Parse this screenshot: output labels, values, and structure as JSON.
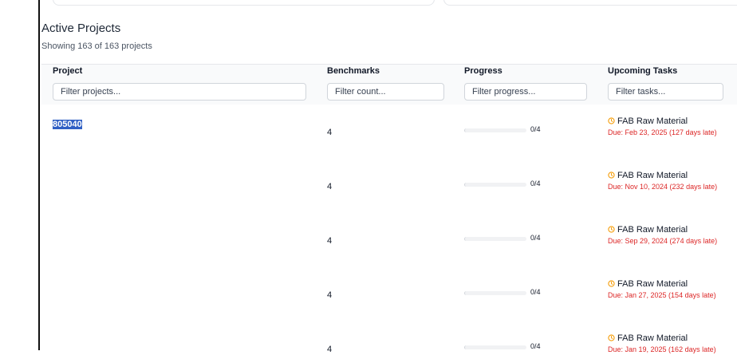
{
  "section": {
    "title": "Active Projects",
    "subtitle": "Showing 163 of 163 projects"
  },
  "columns": {
    "project": {
      "label": "Project",
      "placeholder": "Filter projects..."
    },
    "benchmarks": {
      "label": "Benchmarks",
      "placeholder": "Filter count..."
    },
    "progress": {
      "label": "Progress",
      "placeholder": "Filter progress..."
    },
    "tasks": {
      "label": "Upcoming Tasks",
      "placeholder": "Filter tasks..."
    }
  },
  "colors": {
    "due_overdue": "#dc2626",
    "clock_icon": "#f59e0b",
    "selection": "#2f5fc4"
  },
  "icons": {
    "task": "clock-icon"
  },
  "rows": [
    {
      "project": "805040",
      "benchmarks": "4",
      "progress": "0/4",
      "progress_fraction": 0,
      "task": "FAB Raw Material",
      "due": "Due: Feb 23, 2025 (127 days late)"
    },
    {
      "project": "",
      "benchmarks": "4",
      "progress": "0/4",
      "progress_fraction": 0,
      "task": "FAB Raw Material",
      "due": "Due: Nov 10, 2024 (232 days late)"
    },
    {
      "project": "",
      "benchmarks": "4",
      "progress": "0/4",
      "progress_fraction": 0,
      "task": "FAB Raw Material",
      "due": "Due: Sep 29, 2024 (274 days late)"
    },
    {
      "project": "",
      "benchmarks": "4",
      "progress": "0/4",
      "progress_fraction": 0,
      "task": "FAB Raw Material",
      "due": "Due: Jan 27, 2025 (154 days late)"
    },
    {
      "project": "",
      "benchmarks": "4",
      "progress": "0/4",
      "progress_fraction": 0,
      "task": "FAB Raw Material",
      "due": "Due: Jan 19, 2025 (162 days late)"
    }
  ]
}
